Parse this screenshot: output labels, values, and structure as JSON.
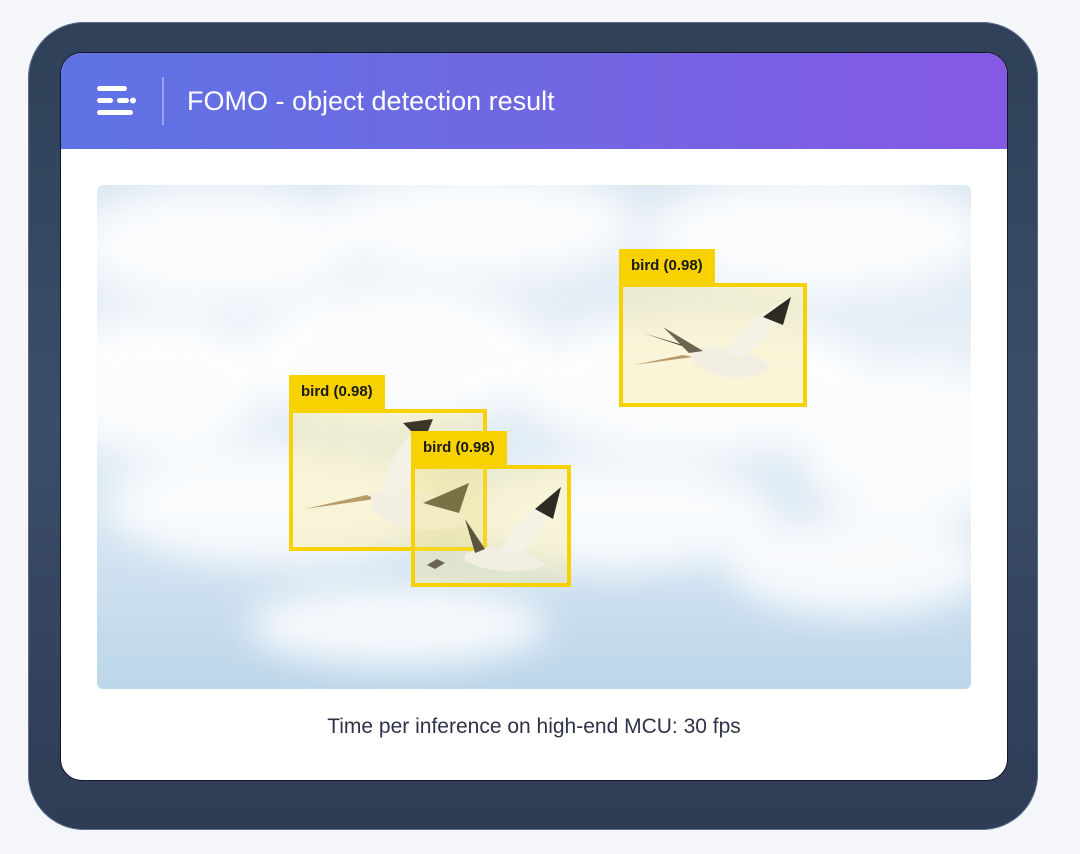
{
  "header": {
    "title": "FOMO - object detection result",
    "menu_icon": "menu-lines-icon",
    "gradient": [
      "#5f73e4",
      "#8659e4"
    ]
  },
  "detections": [
    {
      "label": "bird (0.98)"
    },
    {
      "label": "bird (0.98)"
    },
    {
      "label": "bird (0.98)"
    }
  ],
  "caption": "Time per inference on high-end MCU: 30 fps",
  "colors": {
    "bbox": "#f7d200",
    "caption_text": "#2f3248"
  }
}
